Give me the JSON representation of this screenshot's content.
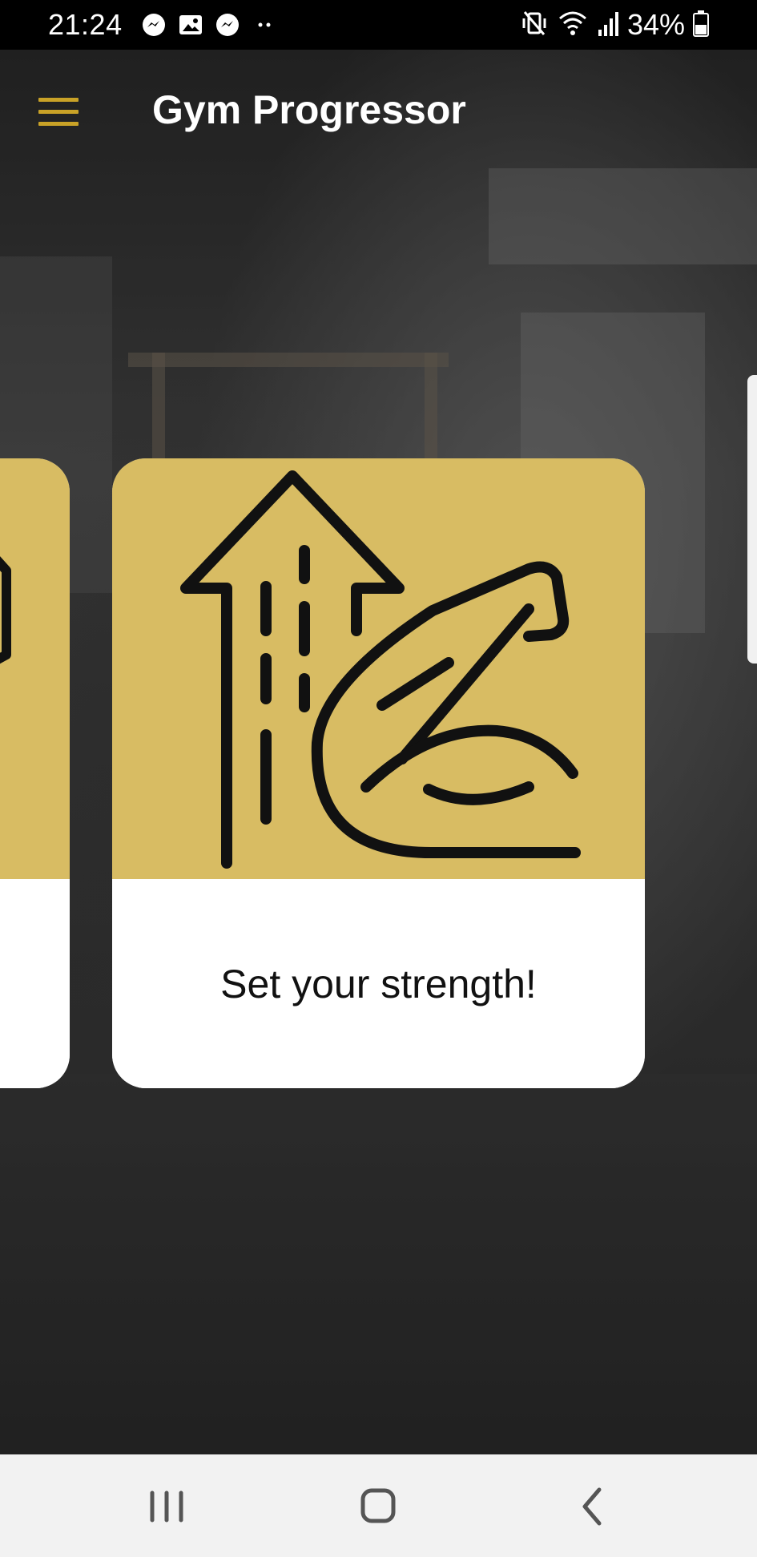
{
  "status_bar": {
    "time": "21:24",
    "battery": "34%",
    "icons_left": [
      "messenger-icon",
      "image-icon",
      "messenger-icon",
      "more-dots-icon"
    ],
    "icons_right": [
      "vibrate-mute-icon",
      "wifi-icon",
      "signal-icon",
      "battery-icon"
    ]
  },
  "app_bar": {
    "title": "Gym Progressor",
    "menu_icon": "hamburger-menu-icon"
  },
  "carousel": {
    "cards": [
      {
        "caption": "",
        "icon": "dumbbell-icon"
      },
      {
        "caption": "Set your strength!",
        "icon": "arrow-up-bicep-icon"
      }
    ]
  },
  "colors": {
    "accent": "#C9A227",
    "card_background": "#FFFFFF",
    "status_bar": "#000000",
    "nav_bar": "#F2F2F2"
  },
  "nav_bar": {
    "buttons": [
      "recent-apps-icon",
      "home-icon",
      "back-icon"
    ]
  }
}
